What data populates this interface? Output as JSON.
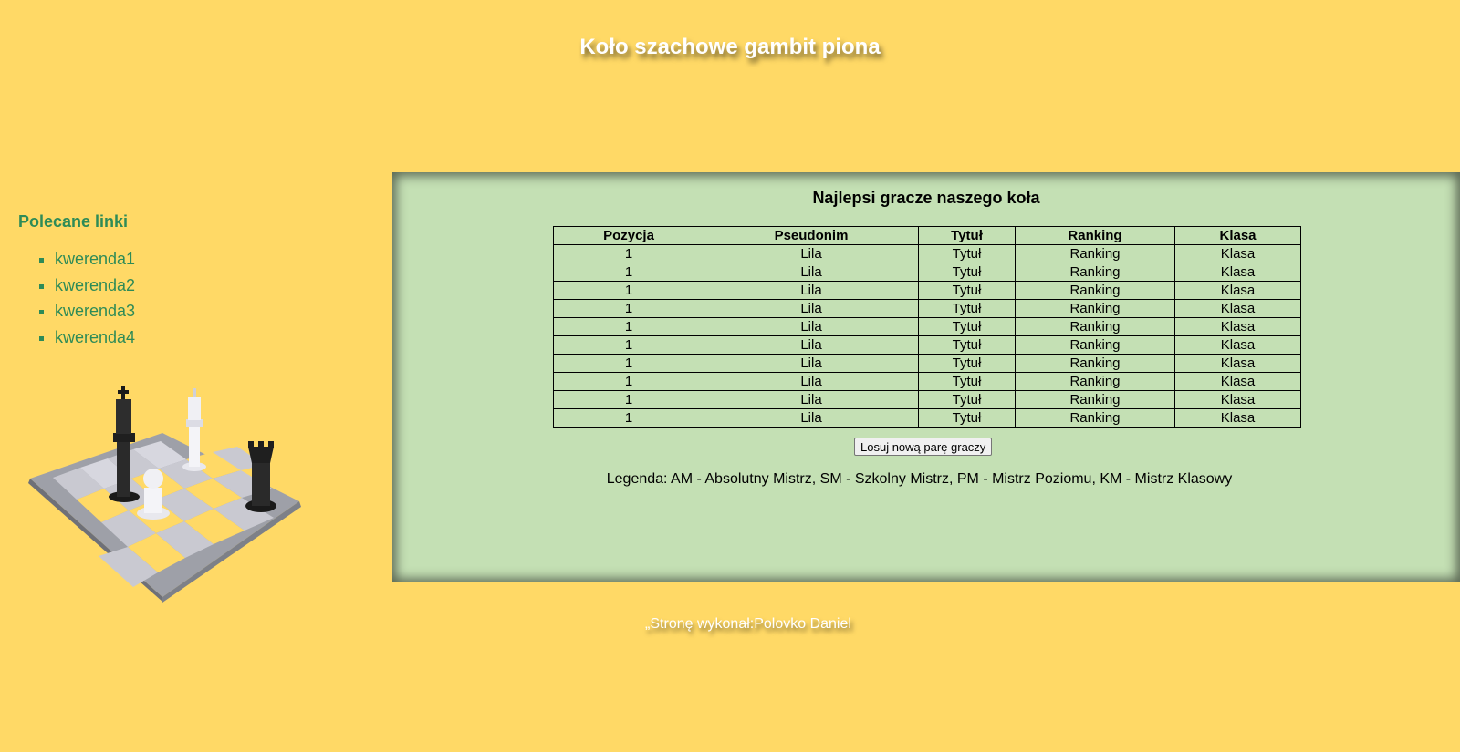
{
  "header": {
    "title": "Koło szachowe gambit piona"
  },
  "sidebar": {
    "heading": "Polecane linki",
    "links": [
      "kwerenda1",
      "kwerenda2",
      "kwerenda3",
      "kwerenda4"
    ],
    "image_icon": "chess-pieces-icon"
  },
  "main": {
    "heading": "Najlepsi gracze naszego koła",
    "table": {
      "headers": [
        "Pozycja",
        "Pseudonim",
        "Tytuł",
        "Ranking",
        "Klasa"
      ],
      "rows": [
        [
          "1",
          "Lila",
          "Tytuł",
          "Ranking",
          "Klasa"
        ],
        [
          "1",
          "Lila",
          "Tytuł",
          "Ranking",
          "Klasa"
        ],
        [
          "1",
          "Lila",
          "Tytuł",
          "Ranking",
          "Klasa"
        ],
        [
          "1",
          "Lila",
          "Tytuł",
          "Ranking",
          "Klasa"
        ],
        [
          "1",
          "Lila",
          "Tytuł",
          "Ranking",
          "Klasa"
        ],
        [
          "1",
          "Lila",
          "Tytuł",
          "Ranking",
          "Klasa"
        ],
        [
          "1",
          "Lila",
          "Tytuł",
          "Ranking",
          "Klasa"
        ],
        [
          "1",
          "Lila",
          "Tytuł",
          "Ranking",
          "Klasa"
        ],
        [
          "1",
          "Lila",
          "Tytuł",
          "Ranking",
          "Klasa"
        ],
        [
          "1",
          "Lila",
          "Tytuł",
          "Ranking",
          "Klasa"
        ]
      ]
    },
    "button_label": "Losuj nową parę graczy",
    "legend": "Legenda: AM - Absolutny Mistrz, SM - Szkolny Mistrz, PM - Mistrz Poziomu, KM - Mistrz Klasowy"
  },
  "footer": {
    "text": "„Stronę wykonał:Polovko Daniel"
  },
  "colors": {
    "background": "#FFD966",
    "panel": "#C4E0B4",
    "link": "#2e8b57",
    "title": "#ffffff"
  }
}
